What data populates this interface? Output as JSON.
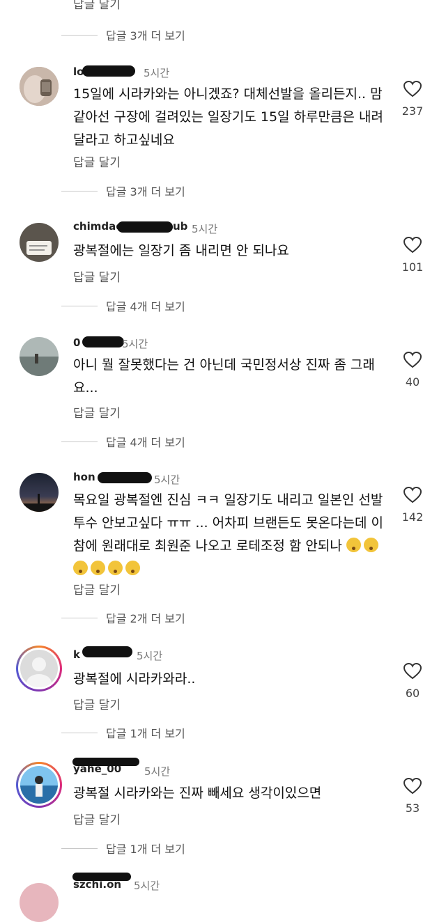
{
  "top": {
    "reply_action": "답글 달기",
    "more_replies": "답글 3개 더 보기"
  },
  "comments": [
    {
      "username": "lo",
      "time": "5시간",
      "text": "15일에 시라카와는 아니겠죠? 대체선발을 올리든지.. 맘같아선 구장에 걸려있는 일장기도 15일 하루만큼은 내려달라고 하고싶네요",
      "reply_action": "답글 달기",
      "likes": "237",
      "more_replies": "답글 3개 더 보기"
    },
    {
      "username": "chimdaek",
      "username_tail": "ub",
      "time": "5시간",
      "text": "광복절에는 일장기 좀 내리면 안 되나요",
      "reply_action": "답글 달기",
      "likes": "101",
      "more_replies": "답글 4개 더 보기"
    },
    {
      "username": "0",
      "time": "5시간",
      "text": "아니 뭘 잘못했다는 건 아닌데 국민정서상 진짜 좀 그래요...",
      "reply_action": "답글 달기",
      "likes": "40",
      "more_replies": "답글 4개 더 보기"
    },
    {
      "username": "hon",
      "time": "5시간",
      "text": "목요일 광복절엔 진심 ㅋㅋ 일장기도 내리고 일본인 선발투수 안보고싶다 ㅠㅠ ... 어차피 브랜든도 못온다는데 이 참에 원래대로 최원준 나오고 로테조정 함 안되나",
      "reply_action": "답글 달기",
      "likes": "142",
      "more_replies": "답글 2개 더 보기",
      "emoji_count": 6
    },
    {
      "username": "k",
      "time": "5시간",
      "text": "광복절에 시라카와라..",
      "reply_action": "답글 달기",
      "likes": "60",
      "more_replies": "답글 1개 더 보기"
    },
    {
      "username": "yahe_00",
      "time": "5시간",
      "text": "광복절 시라카와는 진짜 빼세요 생각이있으면",
      "reply_action": "답글 달기",
      "likes": "53",
      "more_replies": "답글 1개 더 보기"
    },
    {
      "username": "szchi.on",
      "time": "5시간"
    }
  ],
  "icons": {
    "like": "heart-outline-icon"
  },
  "colors": {
    "story_ring": "#dd2a7b",
    "emoji": "#f2c43a"
  }
}
